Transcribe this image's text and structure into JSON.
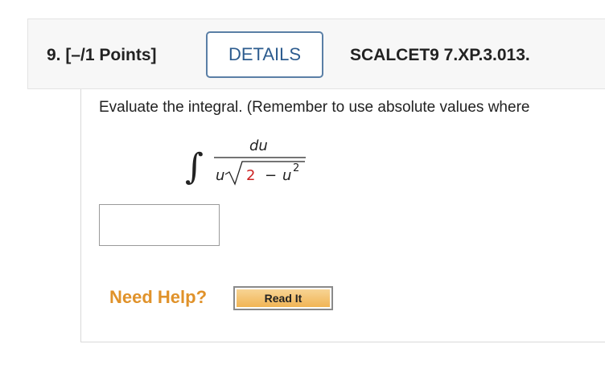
{
  "question": {
    "label": "9. [–/1 Points]",
    "details_label": "DETAILS",
    "source": "SCALCET9 7.XP.3.013."
  },
  "prompt": "Evaluate the integral. (Remember to use absolute values where",
  "integral": {
    "symbol": "∫",
    "numerator": "du",
    "denominator_u": "u",
    "radicand_constant": "2",
    "radicand_minus": "−",
    "radicand_var": "u",
    "exponent": "2",
    "constant_color": "#cc2222"
  },
  "answer": {
    "value": "",
    "placeholder": ""
  },
  "help": {
    "label": "Need Help?",
    "read_it_label": "Read It"
  },
  "colors": {
    "accent": "#2d5c8f",
    "help": "#e0922a",
    "button": "#f0b24f"
  }
}
